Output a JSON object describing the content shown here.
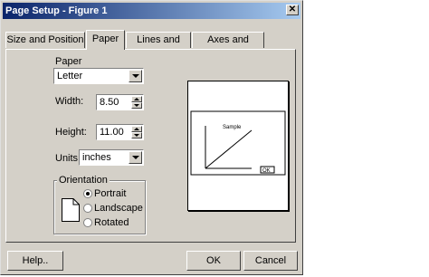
{
  "window": {
    "title": "Page Setup - Figure 1",
    "close_glyph": "✕"
  },
  "tabs": [
    {
      "label": "Size and Position"
    },
    {
      "label": "Paper"
    },
    {
      "label": "Lines and Text"
    },
    {
      "label": "Axes and Figure"
    }
  ],
  "paper": {
    "paper_size_label": "Paper size:",
    "paper_size_value": "Letter",
    "width_label": "Width:",
    "width_value": "8.50",
    "height_label": "Height:",
    "height_value": "11.00",
    "units_label": "Units:",
    "units_value": "inches",
    "orientation": {
      "label": "Orientation",
      "options": [
        "Portrait",
        "Landscape",
        "Rotated"
      ],
      "selected": "Portrait"
    }
  },
  "preview": {
    "plot_title": "Sample",
    "button_label": "OK"
  },
  "footer": {
    "help": "Help..",
    "ok": "OK",
    "cancel": "Cancel"
  }
}
